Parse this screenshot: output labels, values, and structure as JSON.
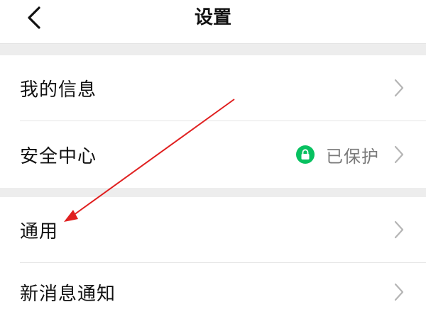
{
  "header": {
    "title": "设置",
    "back_icon": "chevron-left-icon"
  },
  "settings": {
    "group_1": [
      {
        "label": "我的信息"
      },
      {
        "label": "安全中心",
        "status_text": "已保护",
        "status_icon": "lock-icon",
        "status_color": "#07c160"
      }
    ],
    "group_2": [
      {
        "label": "通用"
      },
      {
        "label": "新消息通知"
      }
    ]
  },
  "annotation": {
    "arrow_color": "#e02020"
  }
}
